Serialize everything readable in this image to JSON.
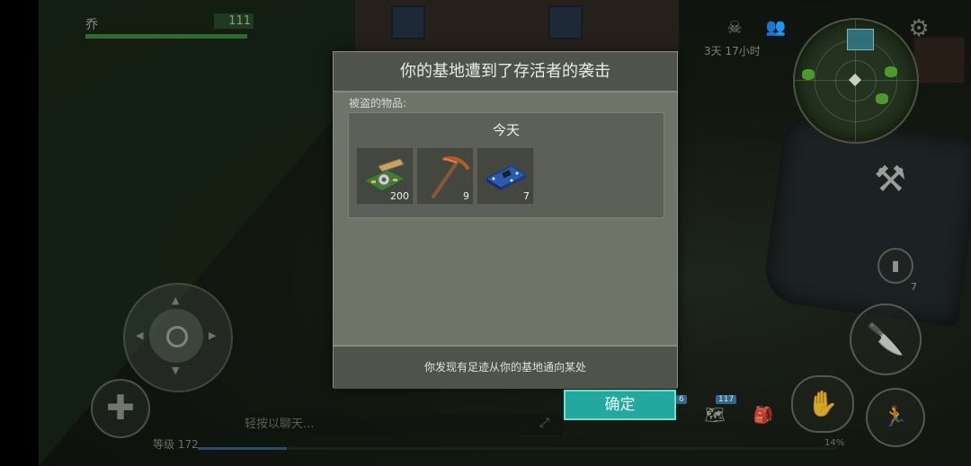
{
  "hud": {
    "player_name": "乔",
    "health": "111",
    "time_remaining": "3天 17小时",
    "chat_placeholder": "轻按以聊天...",
    "level_text": "等级 172",
    "xp_percent": "14%",
    "badges": {
      "inventory_count": "117",
      "left_small": "6"
    },
    "side_item_count": "7",
    "icons": [
      "skull-icon",
      "people-icon",
      "gear-icon",
      "hammer-icon",
      "heal-icon",
      "hand-icon",
      "backpack-icon",
      "map-icon",
      "sneak-icon"
    ]
  },
  "dialog": {
    "title": "你的基地遭到了存活者的袭击",
    "stolen_label": "被盗的物品:",
    "day_label": "今天",
    "items": [
      {
        "icon": "circuit-board-icon",
        "count": "200"
      },
      {
        "icon": "pickaxe-icon",
        "count": "9"
      },
      {
        "icon": "microchip-icon",
        "count": "7"
      }
    ],
    "footer": "你发现有足迹从你的基地通向某处",
    "confirm_label": "确定"
  },
  "colors": {
    "confirm_bg": "#22a89e",
    "dialog_bg": "#6f7468",
    "dialog_header": "#4f5349"
  }
}
